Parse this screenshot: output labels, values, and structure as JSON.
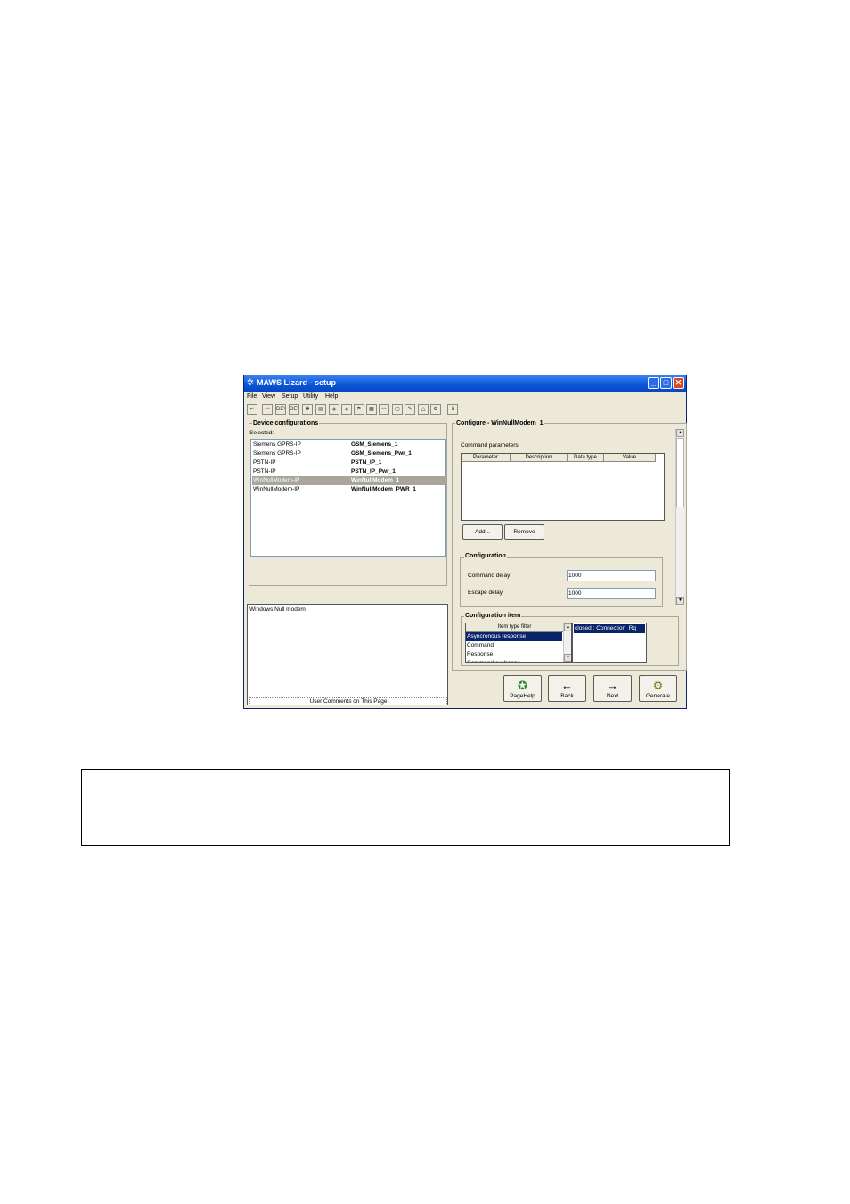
{
  "window": {
    "title": "MAWS Lizard - setup",
    "min_glyph": "_",
    "max_glyph": "□",
    "close_glyph": "✕",
    "app_glyph": "✲"
  },
  "menu": [
    "File",
    "View",
    "Setup",
    "Utility",
    "Help"
  ],
  "toolbar": {
    "tools": [
      {
        "glyph": "↩",
        "name": "undo-icon"
      },
      {
        "glyph": "⚯",
        "name": "network-icon"
      },
      {
        "glyph": "DEV",
        "name": "device-icon"
      },
      {
        "glyph": "DEV",
        "name": "device-edit-icon"
      },
      {
        "glyph": "✱",
        "name": "sensor-icon"
      },
      {
        "glyph": "▤",
        "name": "logger-icon"
      },
      {
        "glyph": "⚶",
        "name": "wind-icon"
      },
      {
        "glyph": "⚶",
        "name": "wind-2-icon"
      },
      {
        "glyph": "⚑",
        "name": "flag-icon"
      },
      {
        "glyph": "▦",
        "name": "grid-icon"
      },
      {
        "glyph": "⚯",
        "name": "link-icon"
      },
      {
        "glyph": "▢",
        "name": "page-icon"
      },
      {
        "glyph": "✎",
        "name": "edit-icon"
      },
      {
        "glyph": "△",
        "name": "alarm-icon"
      },
      {
        "glyph": "⚙",
        "name": "settings-icon"
      },
      {
        "glyph": "ℹ",
        "name": "info-icon"
      }
    ]
  },
  "left": {
    "group_title": "Device configurations",
    "selected_label": "Selected:",
    "devices": [
      {
        "type": "Siemens GPRS-IP",
        "name": "GSM_Siemens_1"
      },
      {
        "type": "Siemens GPRS-IP",
        "name": "GSM_Siemens_Pwr_1"
      },
      {
        "type": "PSTN-IP",
        "name": "PSTN_IP_1"
      },
      {
        "type": "PSTN-IP",
        "name": "PSTN_IP_Pwr_1"
      },
      {
        "type": "WinNullModem-IP",
        "name": "WinNullModem_1"
      },
      {
        "type": "WinNullModem-IP",
        "name": "WinNullModem_PWR_1"
      }
    ],
    "selected_index": 4,
    "comment_text": "Windows Null modem",
    "comment_footer": "User Comments on This Page"
  },
  "right": {
    "group_title": "Configure - WinNullModem_1",
    "command_params_label": "Command parameters",
    "columns": [
      "Parameter",
      "Description",
      "Data type",
      "Value"
    ],
    "add_label": "Add...",
    "remove_label": "Remove",
    "config_title": "Configuration",
    "command_delay_label": "Command delay",
    "command_delay_value": "1000",
    "escape_delay_label": "Escape delay",
    "escape_delay_value": "1000",
    "config_item_title": "Configuration item",
    "filter_header": "Item type filter",
    "filter_items": [
      "Asyncronous response",
      "Command",
      "Response",
      "Command exchange"
    ],
    "filter_selected": 0,
    "item_values": [
      "closed : Connection_Rq"
    ]
  },
  "nav": {
    "pagehelp_label": "PageHelp",
    "back_label": "Back",
    "next_label": "Next",
    "generate_label": "Generate",
    "pagehelp_glyph": "✪",
    "back_glyph": "←",
    "next_glyph": "→",
    "generate_glyph": "⚙"
  }
}
